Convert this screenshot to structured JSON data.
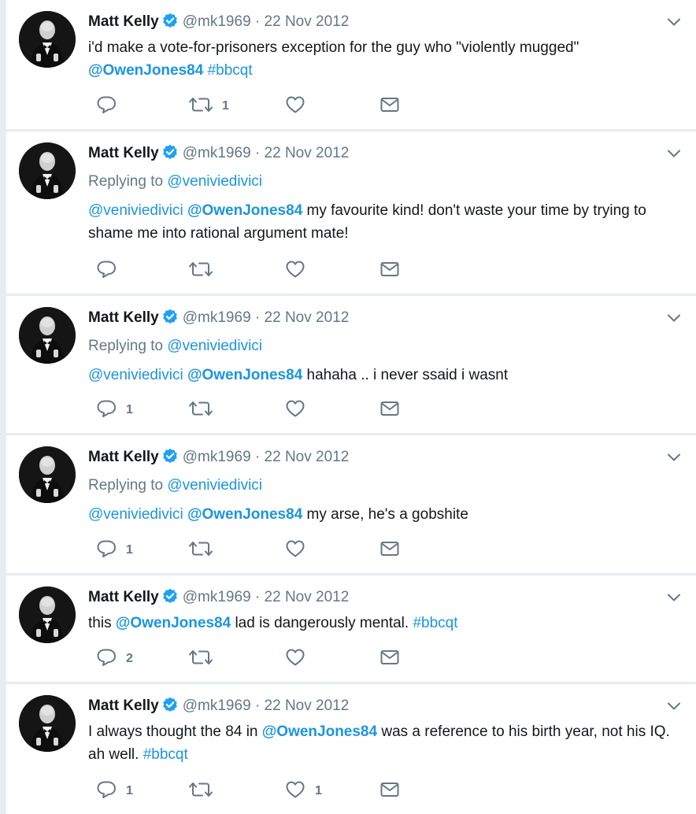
{
  "colors": {
    "link": "#1b95e0",
    "muted": "#657786",
    "text": "#14171a",
    "verified": "#1da1f2",
    "divider": "#e6ecf0"
  },
  "icons": {
    "reply": "reply-icon",
    "retweet": "retweet-icon",
    "like": "heart-icon",
    "dm": "envelope-icon",
    "caret": "chevron-down-icon",
    "verified": "verified-badge-icon"
  },
  "tweets": [
    {
      "name": "Matt Kelly",
      "handle": "@mk1969",
      "sep": " · ",
      "date": "22 Nov 2012",
      "replying_label": "",
      "replying_to": "",
      "segments": [
        {
          "t": "text",
          "v": "i'd make a vote-for-prisoners exception for the guy who \"violently mugged\" "
        },
        {
          "t": "mention-bold",
          "v": "@OwenJones84"
        },
        {
          "t": "text",
          "v": " "
        },
        {
          "t": "link",
          "v": "#bbcqt"
        }
      ],
      "counts": {
        "reply": "",
        "retweet": "1",
        "like": ""
      }
    },
    {
      "name": "Matt Kelly",
      "handle": "@mk1969",
      "sep": " · ",
      "date": "22 Nov 2012",
      "replying_label": "Replying to ",
      "replying_to": "@veniviedivici",
      "segments": [
        {
          "t": "link",
          "v": "@veniviedivici"
        },
        {
          "t": "text",
          "v": " "
        },
        {
          "t": "mention-bold",
          "v": "@OwenJones84"
        },
        {
          "t": "text",
          "v": " my favourite kind! don't waste your time by trying to shame me into rational argument mate!"
        }
      ],
      "counts": {
        "reply": "",
        "retweet": "",
        "like": ""
      }
    },
    {
      "name": "Matt Kelly",
      "handle": "@mk1969",
      "sep": " · ",
      "date": "22 Nov 2012",
      "replying_label": "Replying to ",
      "replying_to": "@veniviedivici",
      "segments": [
        {
          "t": "link",
          "v": "@veniviedivici"
        },
        {
          "t": "text",
          "v": " "
        },
        {
          "t": "mention-bold",
          "v": "@OwenJones84"
        },
        {
          "t": "text",
          "v": " hahaha .. i never ssaid i wasnt"
        }
      ],
      "counts": {
        "reply": "1",
        "retweet": "",
        "like": ""
      }
    },
    {
      "name": "Matt Kelly",
      "handle": "@mk1969",
      "sep": " · ",
      "date": "22 Nov 2012",
      "replying_label": "Replying to ",
      "replying_to": "@veniviedivici",
      "segments": [
        {
          "t": "link",
          "v": "@veniviedivici"
        },
        {
          "t": "text",
          "v": " "
        },
        {
          "t": "mention-bold",
          "v": "@OwenJones84"
        },
        {
          "t": "text",
          "v": " my arse, he's a gobshite"
        }
      ],
      "counts": {
        "reply": "1",
        "retweet": "",
        "like": ""
      }
    },
    {
      "name": "Matt Kelly",
      "handle": "@mk1969",
      "sep": " · ",
      "date": "22 Nov 2012",
      "replying_label": "",
      "replying_to": "",
      "segments": [
        {
          "t": "text",
          "v": "this "
        },
        {
          "t": "mention-bold",
          "v": "@OwenJones84"
        },
        {
          "t": "text",
          "v": " lad is dangerously mental. "
        },
        {
          "t": "link",
          "v": "#bbcqt"
        }
      ],
      "counts": {
        "reply": "2",
        "retweet": "",
        "like": ""
      }
    },
    {
      "name": "Matt Kelly",
      "handle": "@mk1969",
      "sep": " · ",
      "date": "22 Nov 2012",
      "replying_label": "",
      "replying_to": "",
      "segments": [
        {
          "t": "text",
          "v": "I always thought the 84 in "
        },
        {
          "t": "mention-bold",
          "v": "@OwenJones84"
        },
        {
          "t": "text",
          "v": " was a reference to his birth year, not his IQ. ah well. "
        },
        {
          "t": "link",
          "v": "#bbcqt"
        }
      ],
      "counts": {
        "reply": "1",
        "retweet": "",
        "like": "1"
      }
    }
  ]
}
